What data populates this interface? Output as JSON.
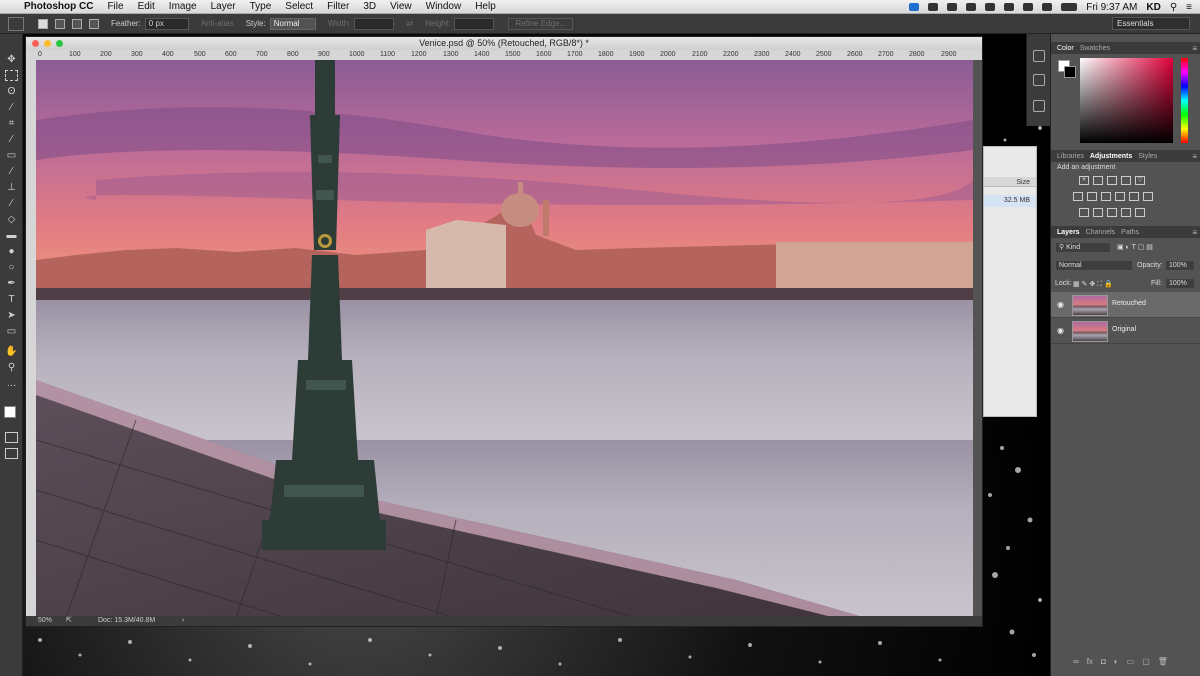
{
  "menubar": {
    "app": "Photoshop CC",
    "items": [
      "File",
      "Edit",
      "Image",
      "Layer",
      "Type",
      "Select",
      "Filter",
      "3D",
      "View",
      "Window",
      "Help"
    ],
    "clock": "Fri 9:37 AM",
    "user": "KD"
  },
  "options": {
    "feather_label": "Feather:",
    "feather_value": "0 px",
    "antialias": "Anti-alias",
    "style_label": "Style:",
    "style_value": "Normal",
    "width_label": "Width:",
    "height_label": "Height:",
    "refine_edge": "Refine Edge...",
    "workspace": "Essentials"
  },
  "document": {
    "title": "Venice.psd @ 50% (Retouched, RGB/8*) *",
    "ruler_ticks": [
      "0",
      "100",
      "200",
      "300",
      "400",
      "500",
      "600",
      "700",
      "800",
      "900",
      "1000",
      "1100",
      "1200",
      "1300",
      "1400",
      "1500",
      "1600",
      "1700",
      "1800",
      "1900",
      "2000",
      "2100",
      "2200",
      "2300",
      "2400",
      "2500",
      "2600",
      "2700",
      "2800",
      "2900"
    ],
    "zoom": "50%",
    "doc_size": "Doc: 15.3M/40.8M"
  },
  "bg_dialog": {
    "size_header": "Size",
    "size_value": "32.5 MB"
  },
  "panels": {
    "color_tabs": [
      "Color",
      "Swatches"
    ],
    "adjust_tabs": [
      "Libraries",
      "Adjustments",
      "Styles"
    ],
    "add_adjustment": "Add an adjustment",
    "layers_tabs": [
      "Layers",
      "Channels",
      "Paths"
    ],
    "kind": "Kind",
    "blend_mode": "Normal",
    "opacity_label": "Opacity:",
    "opacity_value": "100%",
    "lock_label": "Lock:",
    "fill_label": "Fill:",
    "fill_value": "100%",
    "layers": [
      {
        "name": "Retouched",
        "visible": true,
        "selected": true
      },
      {
        "name": "Original",
        "visible": true,
        "selected": false
      }
    ]
  },
  "colors": {
    "accent": "#e0003a",
    "panel_bg": "#535353",
    "chrome_dark": "#3b3b3b"
  }
}
